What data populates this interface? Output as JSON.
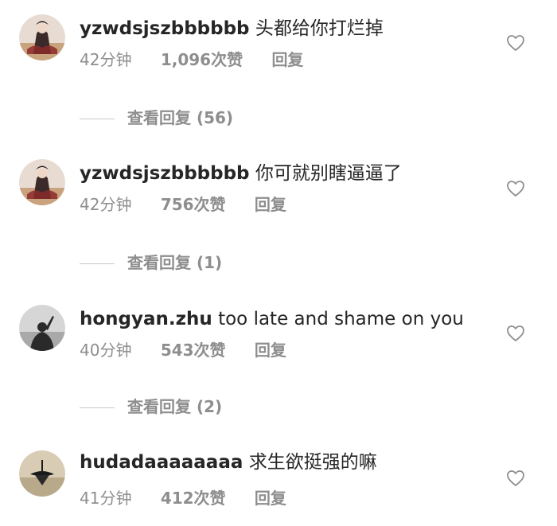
{
  "comments": [
    {
      "username": "yzwdsjszbbbbbb",
      "text": "头都给你打烂掉",
      "time": "42分钟",
      "likes": "1,096次赞",
      "reply_label": "回复",
      "view_replies": "查看回复 (56)",
      "avatar_icon": "avatar-costume-figure-icon"
    },
    {
      "username": "yzwdsjszbbbbbb",
      "text": "你可就别瞎逼逼了",
      "time": "42分钟",
      "likes": "756次赞",
      "reply_label": "回复",
      "view_replies": "查看回复 (1)",
      "avatar_icon": "avatar-costume-figure-icon"
    },
    {
      "username": "hongyan.zhu",
      "text": "too late and shame on you",
      "time": "40分钟",
      "likes": "543次赞",
      "reply_label": "回复",
      "view_replies": "查看回复 (2)",
      "avatar_icon": "avatar-silhouette-icon"
    },
    {
      "username": "hudadaaaaaaaa",
      "text": "求生欲挺强的嘛",
      "time": "41分钟",
      "likes": "412次赞",
      "reply_label": "回复",
      "avatar_icon": "avatar-spinning-top-icon"
    }
  ],
  "icons": {
    "like": "heart-outline-icon"
  },
  "colors": {
    "text_primary": "#262626",
    "text_secondary": "#8e8e8e",
    "divider": "#c7c7c7"
  }
}
